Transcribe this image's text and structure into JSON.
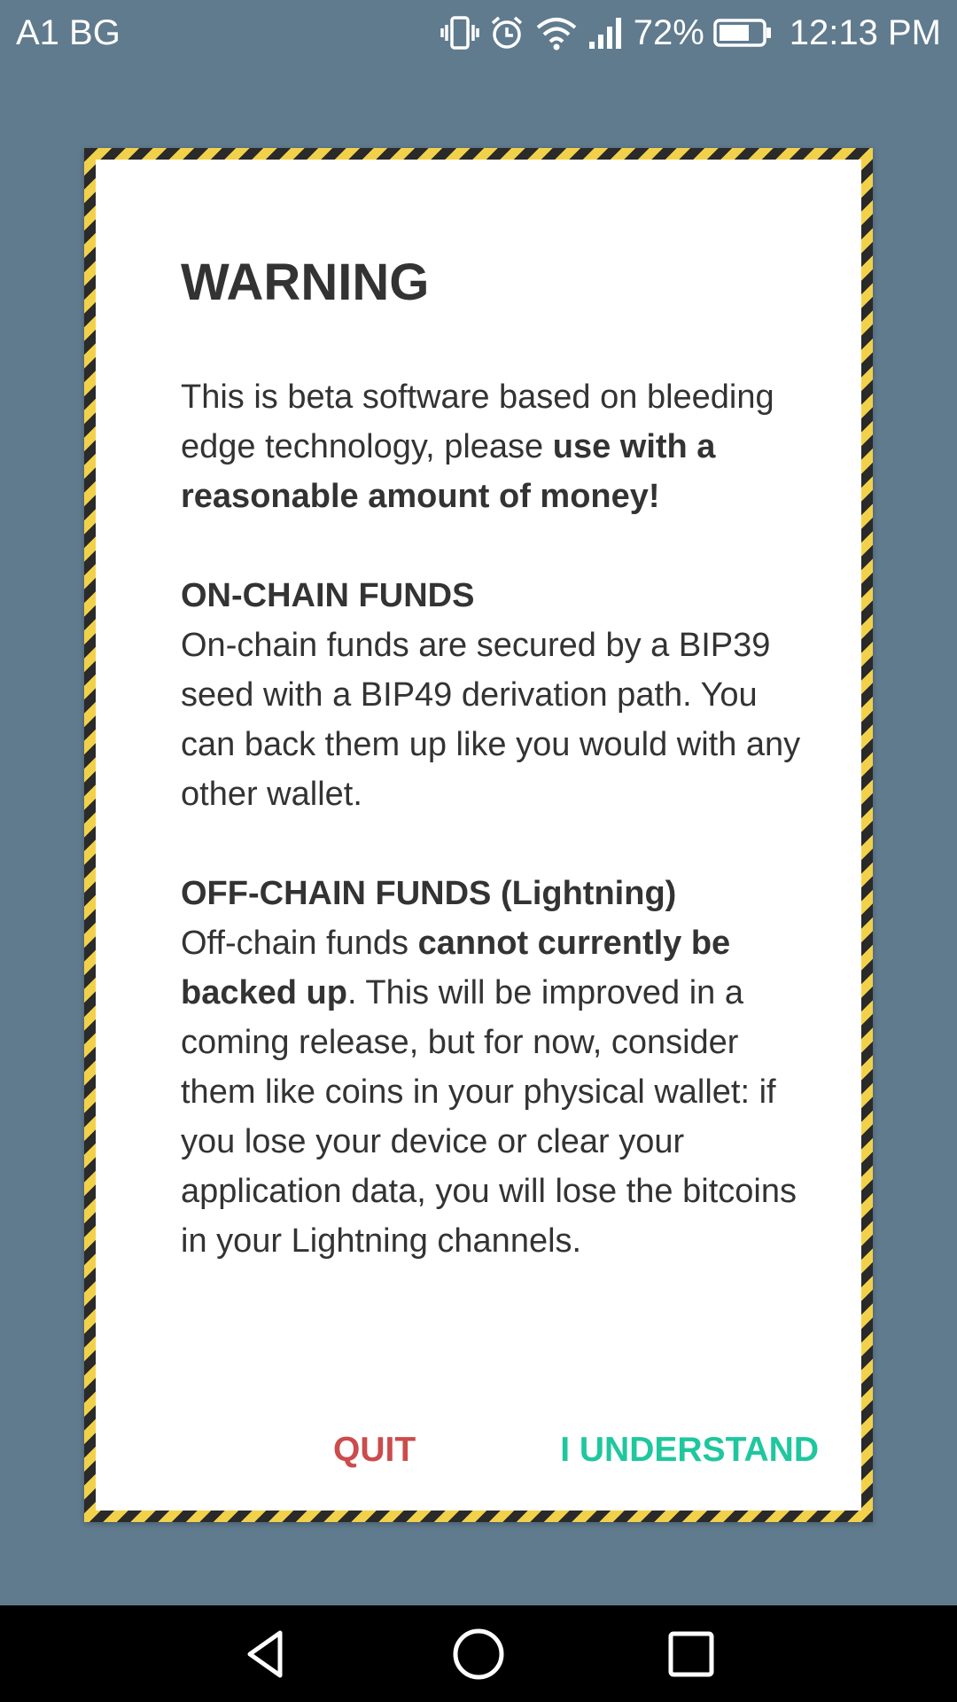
{
  "status_bar": {
    "carrier": "A1 BG",
    "battery_percent": "72%",
    "battery_level": 0.72,
    "time": "12:13 PM",
    "icons": [
      "vibrate-icon",
      "alarm-icon",
      "wifi-icon",
      "signal-icon",
      "battery-icon"
    ]
  },
  "dialog": {
    "title": "WARNING",
    "intro_text": "This is beta software based on bleeding edge technology, please ",
    "intro_bold": "use with a reasonable amount of money!",
    "onchain_title": "ON-CHAIN FUNDS",
    "onchain_text": "On-chain funds are secured by a BIP39 seed with a BIP49 derivation path. You can back them up like you would with any other wallet.",
    "offchain_title": "OFF-CHAIN FUNDS (Lightning)",
    "offchain_text_1": "Off-chain funds ",
    "offchain_bold": "cannot currently be backed up",
    "offchain_text_2": ". This will be improved in a coming release, but for now, consider them like coins in your physical wallet: if you lose your device or clear your application data, you will lose the bitcoins in your Lightning channels.",
    "quit_label": "QUIT",
    "understand_label": "I UNDERSTAND",
    "colors": {
      "quit": "#CC4B4B",
      "understand": "#1FC79E",
      "stripe_dark": "#2A2A2A",
      "stripe_yellow": "#F2D14A"
    }
  },
  "nav_bar": {
    "buttons": [
      "back-icon",
      "home-icon",
      "recents-icon"
    ]
  },
  "colors": {
    "background": "#607B8E"
  }
}
